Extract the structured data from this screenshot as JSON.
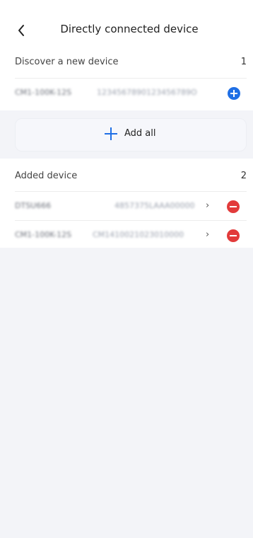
{
  "header": {
    "title": "Directly connected device",
    "back_icon": "chevron-left-icon"
  },
  "discover": {
    "label": "Discover a new device",
    "count": "1",
    "items": [
      {
        "name": "CM1-100K-12S",
        "serial": "1234567890123456789O"
      }
    ]
  },
  "add_all": {
    "label": "Add all"
  },
  "added": {
    "label": "Added device",
    "count": "2",
    "items": [
      {
        "name": "DTSU666",
        "serial": "4857375LAAA00000"
      },
      {
        "name": "CM1-100K-12S",
        "serial": "CM1410021023010000"
      }
    ]
  },
  "colors": {
    "accent": "#1f6fe5",
    "remove": "#e23b3b",
    "background": "#f3f4f8"
  }
}
